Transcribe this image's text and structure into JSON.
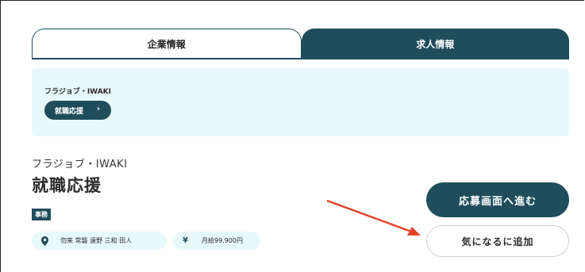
{
  "tabs": {
    "company_info": "企業情報",
    "job_info": "求人情報"
  },
  "info_box": {
    "company_name": "フラジョブ・IWAKI",
    "link_label": "就職応援",
    "link_chevron": "＞"
  },
  "job": {
    "company_name": "フラジョブ・IWAKI",
    "title": "就職応援",
    "category": "事務",
    "location": "勿来 常磐 遠野 三和 田人",
    "salary": "月給99,900円",
    "location_icon": "map-pin-icon",
    "salary_icon": "yen-icon"
  },
  "actions": {
    "apply_label": "応募画面へ進む",
    "favorite_label": "気になるに追加"
  },
  "colors": {
    "primary": "#1f4d5c",
    "light_bg": "#e8f9fa",
    "annotation_arrow": "#e0452b"
  }
}
